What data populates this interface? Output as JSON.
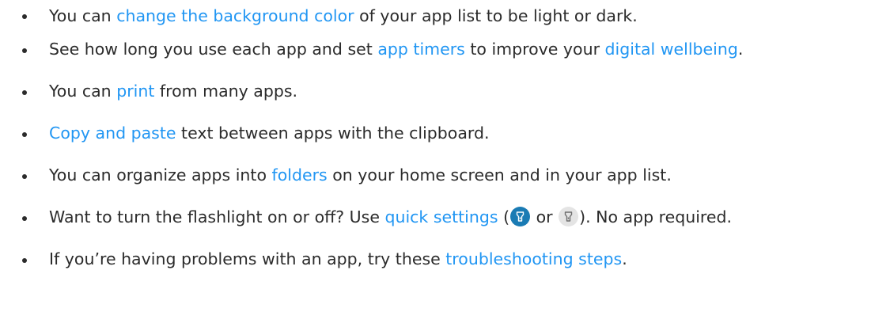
{
  "tips": [
    {
      "before": "You can ",
      "link": "change the background color",
      "after": " of your app list to be light or dark."
    },
    {
      "before": "See how long you use each app and set ",
      "link1": "app timers",
      "middle": " to improve your ",
      "link2": "digital wellbeing",
      "after": "."
    },
    {
      "before": "You can ",
      "link": "print",
      "after": " from many apps."
    },
    {
      "before": "",
      "link": "Copy and paste",
      "after": " text between apps with the clipboard."
    },
    {
      "before": "You can organize apps into ",
      "link": "folders",
      "after": " on your home screen and in your app list."
    },
    {
      "before": "Want to turn the flashlight on or off? Use ",
      "link": "quick settings",
      "paren_open": " (",
      "or_text": " or ",
      "paren_close": "). No app required.",
      "icon_on": "flashlight-on-icon",
      "icon_off": "flashlight-off-icon"
    },
    {
      "before": "If you’re having problems with an app, try these ",
      "link": "troubleshooting steps",
      "after": "."
    }
  ],
  "colors": {
    "text": "#2b2b2b",
    "link": "#2196f3",
    "icon_on_bg": "#1a7bb4",
    "icon_off_bg": "#e4e4e4"
  }
}
